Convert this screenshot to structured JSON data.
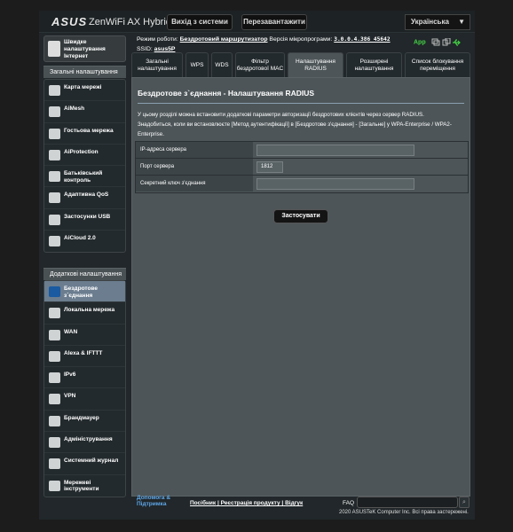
{
  "header": {
    "logo": "ASUS",
    "model": "ZenWiFi AX Hybrid",
    "logout": "Вихід з системи",
    "reboot": "Перезавантажити",
    "language": "Українська"
  },
  "status": {
    "mode_label": "Режим роботи:",
    "mode_value": "Бездротовий маршрутизатор",
    "fw_label": "Версія мікропрограми:",
    "fw_value": "3.0.0.4.386_45642",
    "ssid_label": "SSID:",
    "ssid_value": "asus5P",
    "app_label": "App"
  },
  "sidebar": {
    "quick": "Швидке налаштування Інтернет",
    "general_header": "Загальні налаштування",
    "general": [
      {
        "label": "Карта мережі"
      },
      {
        "label": "AiMesh"
      },
      {
        "label": "Гостьова мережа"
      },
      {
        "label": "AiProtection"
      },
      {
        "label": "Батьківський контроль"
      },
      {
        "label": "Адаптивна QoS"
      },
      {
        "label": "Застосунки USB"
      },
      {
        "label": "AiCloud 2.0"
      }
    ],
    "advanced_header": "Додаткові налаштування",
    "advanced": [
      {
        "label": "Бездротове з`єднання"
      },
      {
        "label": "Локальна мережа"
      },
      {
        "label": "WAN"
      },
      {
        "label": "Alexa & IFTTT"
      },
      {
        "label": "IPv6"
      },
      {
        "label": "VPN"
      },
      {
        "label": "Брандмауер"
      },
      {
        "label": "Адміністрування"
      },
      {
        "label": "Системний журнал"
      },
      {
        "label": "Мережеві інструменти"
      }
    ]
  },
  "tabs": [
    {
      "label": "Загальні налаштування"
    },
    {
      "label": "WPS"
    },
    {
      "label": "WDS"
    },
    {
      "label": "Фільтр бездротової MAC"
    },
    {
      "label": "Налаштування RADIUS"
    },
    {
      "label": "Розширені налаштування"
    },
    {
      "label": "Список блокування переміщення"
    }
  ],
  "panel": {
    "title": "Бездротове з`єднання - Налаштування RADIUS",
    "desc1": "У цьому розділі можна встановити додаткові параметри авторизації бездротових клієнтів через сервер RADIUS.",
    "desc2": "Знадобиться, коли ви встановлюєте [Метод аутентифікації] в [Бездротове з'єднання] - [Загальне] у WPA-Enterprise / WPA2-Enterprise.",
    "fields": [
      {
        "label": "IP-адреса сервера",
        "value": ""
      },
      {
        "label": "Порт сервера",
        "value": "1812"
      },
      {
        "label": "Секретний ключ з'єднання",
        "value": ""
      }
    ],
    "apply": "Застосувати"
  },
  "footer": {
    "help": "Допомога & Підтримка",
    "manual": "Посібник",
    "register": "Реєстрація продукту",
    "feedback": "Відгук",
    "sep": "|",
    "faq": "FAQ",
    "copyright": "2020 ASUSTeK Computer Inc. Всі права застережені."
  }
}
